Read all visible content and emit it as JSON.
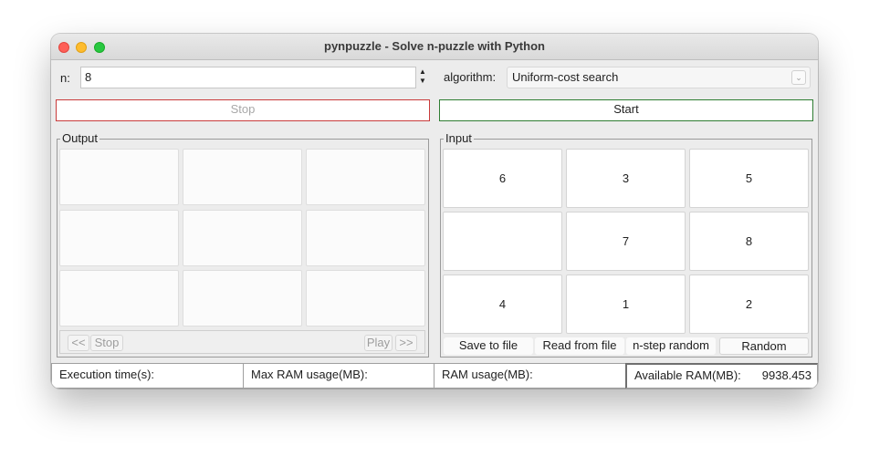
{
  "window": {
    "title": "pynpuzzle - Solve n-puzzle with Python"
  },
  "controls": {
    "n_label": "n:",
    "n_value": "8",
    "algorithm_label": "algorithm:",
    "algorithm_value": "Uniform-cost search",
    "stop_label": "Stop",
    "start_label": "Start"
  },
  "output": {
    "title": "Output",
    "tiles": [
      "",
      "",
      "",
      "",
      "",
      "",
      "",
      "",
      ""
    ],
    "nav": {
      "prev": "<<",
      "stop": "Stop",
      "play": "Play",
      "next": ">>"
    }
  },
  "input": {
    "title": "Input",
    "tiles": [
      "6",
      "3",
      "5",
      "",
      "7",
      "8",
      "4",
      "1",
      "2"
    ],
    "actions": {
      "save": "Save to file",
      "read": "Read from file",
      "nstep": "n-step random",
      "random": "Random"
    }
  },
  "status": {
    "exec_label": "Execution time(s):",
    "max_ram_label": "Max RAM usage(MB):",
    "ram_label": "RAM usage(MB):",
    "avail_label": "Available RAM(MB):",
    "avail_value": "9938.453"
  },
  "colors": {
    "stop_border": "#c93b3b",
    "start_border": "#2e7d32",
    "traffic_red": "#fe5f57",
    "traffic_yellow": "#febc2e",
    "traffic_green": "#28c840"
  },
  "icons": [
    "close-icon",
    "minimize-icon",
    "zoom-icon",
    "spinner-arrows-icon",
    "chevron-down-icon"
  ]
}
